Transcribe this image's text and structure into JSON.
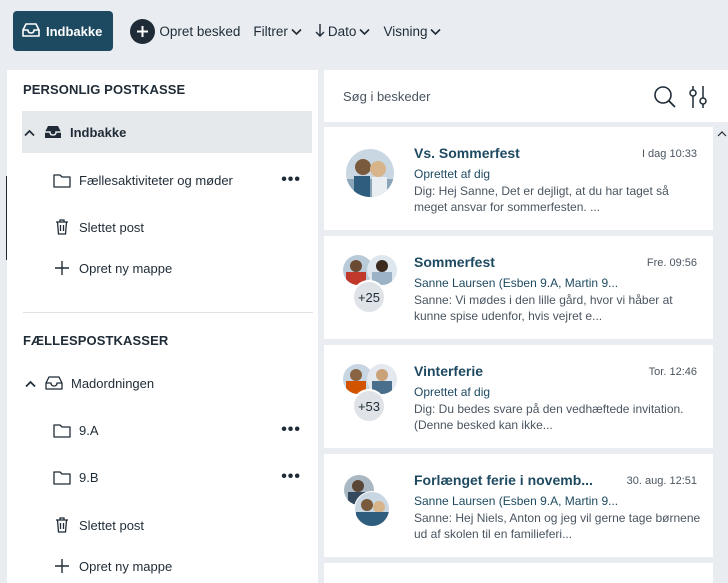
{
  "toolbar": {
    "inbox_button": "Indbakke",
    "new_message": "Opret besked",
    "filter": "Filtrer",
    "date": "Dato",
    "view": "Visning"
  },
  "sidebar": {
    "personal_title": "PERSONLIG POSTKASSE",
    "personal_items": [
      {
        "label": "Indbakke"
      },
      {
        "label": "Fællesaktiviteter og møder"
      },
      {
        "label": "Slettet post"
      },
      {
        "label": "Opret ny mappe"
      }
    ],
    "shared_title": "FÆLLESPOSTKASSER",
    "shared_items": [
      {
        "label": "Madordningen"
      },
      {
        "label": "9.A"
      },
      {
        "label": "9.B"
      },
      {
        "label": "Slettet post"
      },
      {
        "label": "Opret ny mappe"
      }
    ]
  },
  "search": {
    "placeholder": "Søg i beskeder"
  },
  "messages": [
    {
      "title": "Vs. Sommerfest",
      "time": "I dag 10:33",
      "sender": "Oprettet af dig",
      "preview": "Dig: Hej Sanne, Det er dejligt, at du har taget så meget ansvar for sommerfesten. ..."
    },
    {
      "title": "Sommerfest",
      "time": "Fre. 09:56",
      "sender": "Sanne Laursen (Esben 9.A, Martin 9...",
      "preview": "Sanne: Vi mødes i den lille gård, hvor vi håber at kunne spise udenfor, hvis vejret e...",
      "badge": "+25"
    },
    {
      "title": "Vinterferie",
      "time": "Tor. 12:46",
      "sender": "Oprettet af dig",
      "preview": "Dig: Du bedes svare på den vedhæftede invitation. (Denne besked kan ikke...",
      "badge": "+53"
    },
    {
      "title": "Forlænget ferie i novemb...",
      "time": "30. aug. 12:51",
      "sender": "Sanne Laursen (Esben 9.A, Martin 9...",
      "preview": "Sanne: Hej Niels,  Anton og jeg vil gerne tage børnene ud af skolen til en familieferi..."
    }
  ],
  "colors": {
    "accent": "#1e4a61",
    "background": "#e9edf1",
    "selected": "#e6e9ec"
  }
}
